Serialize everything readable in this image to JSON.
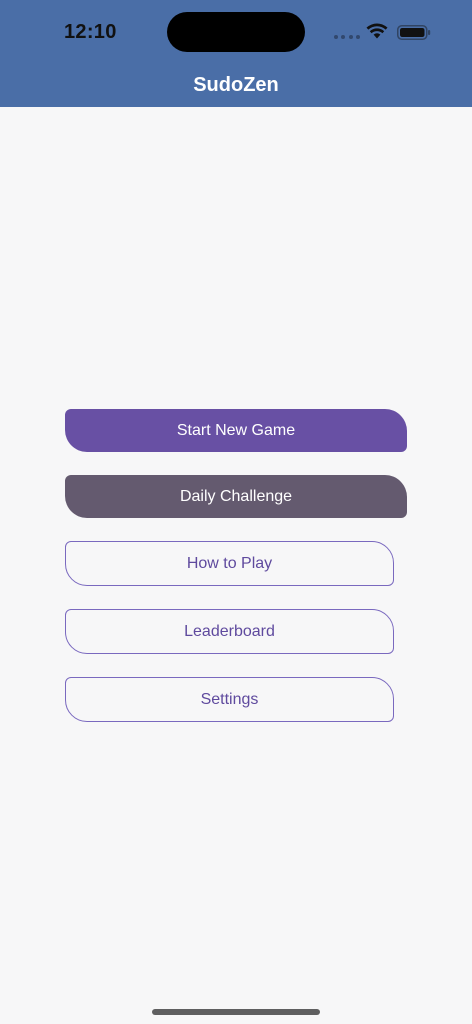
{
  "status_bar": {
    "time": "12:10",
    "icons": [
      "cellular-signal-icon",
      "wifi-icon",
      "battery-icon"
    ]
  },
  "app_bar": {
    "title": "SudoZen"
  },
  "menu": {
    "start_new_game": "Start New Game",
    "daily_challenge": "Daily Challenge",
    "how_to_play": "How to Play",
    "leaderboard": "Leaderboard",
    "settings": "Settings"
  },
  "colors": {
    "app_bar": "#4a6ea7",
    "background": "#f7f7f8",
    "primary_button": "#6850a4",
    "secondary_button": "#645a6f",
    "outline_button_border": "#7a69bf",
    "outline_button_text": "#5f4a9e"
  }
}
